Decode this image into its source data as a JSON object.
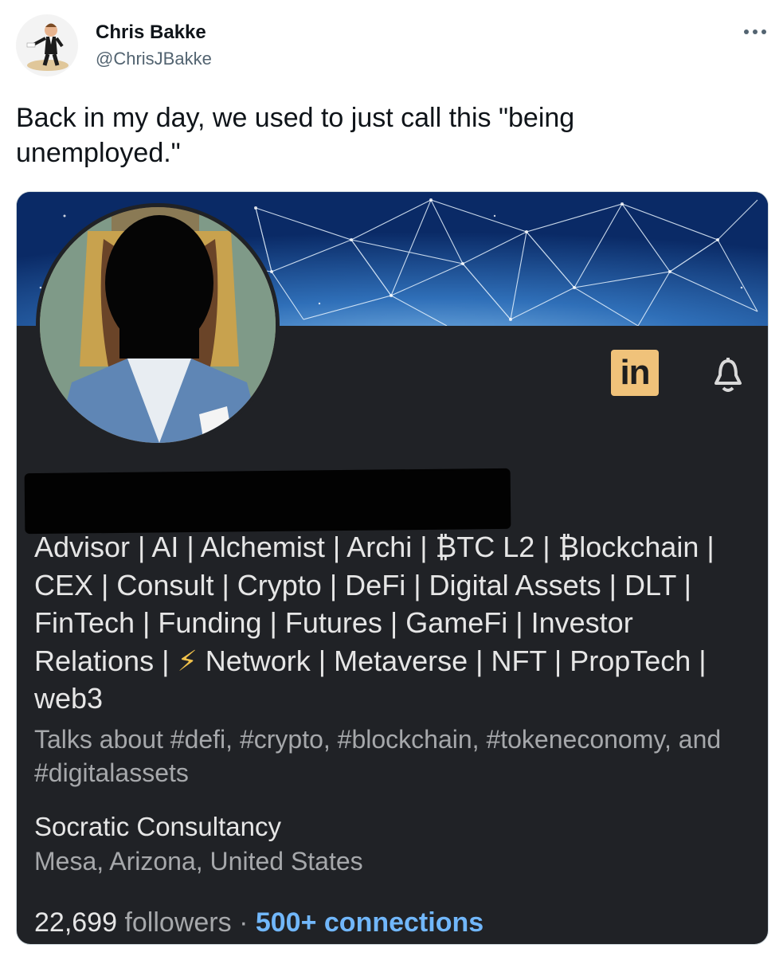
{
  "author": {
    "name": "Chris Bakke",
    "handle": "@ChrisJBakke"
  },
  "tweet": {
    "text": "Back in my day, we used to just call this \"being unemployed.\""
  },
  "profile_card": {
    "headline_part1": "Advisor | AI | Alchemist | Archi | ₿TC L2 | ₿lockchain | CEX | Consult | Crypto | DeFi | Digital Assets | DLT | FinTech | Funding | Futures | GameFi | Investor Relations | ",
    "headline_bolt": "⚡",
    "headline_part2": " Network | Metaverse | NFT | PropTech | web3",
    "talks_about": "Talks about #defi, #crypto, #blockchain, #tokeneconomy, and #digitalassets",
    "company": "Socratic Consultancy",
    "location": "Mesa, Arizona, United States",
    "followers_count": "22,699",
    "followers_label": "followers",
    "separator": "·",
    "connections": "500+ connections",
    "linkedin_badge": "in"
  },
  "icons": [
    "more-icon",
    "linkedin-icon",
    "bell-icon"
  ],
  "colors": {
    "card_background": "#202226",
    "linkedin_badge": "#f0c27a",
    "connections_link": "#71b7fb"
  }
}
